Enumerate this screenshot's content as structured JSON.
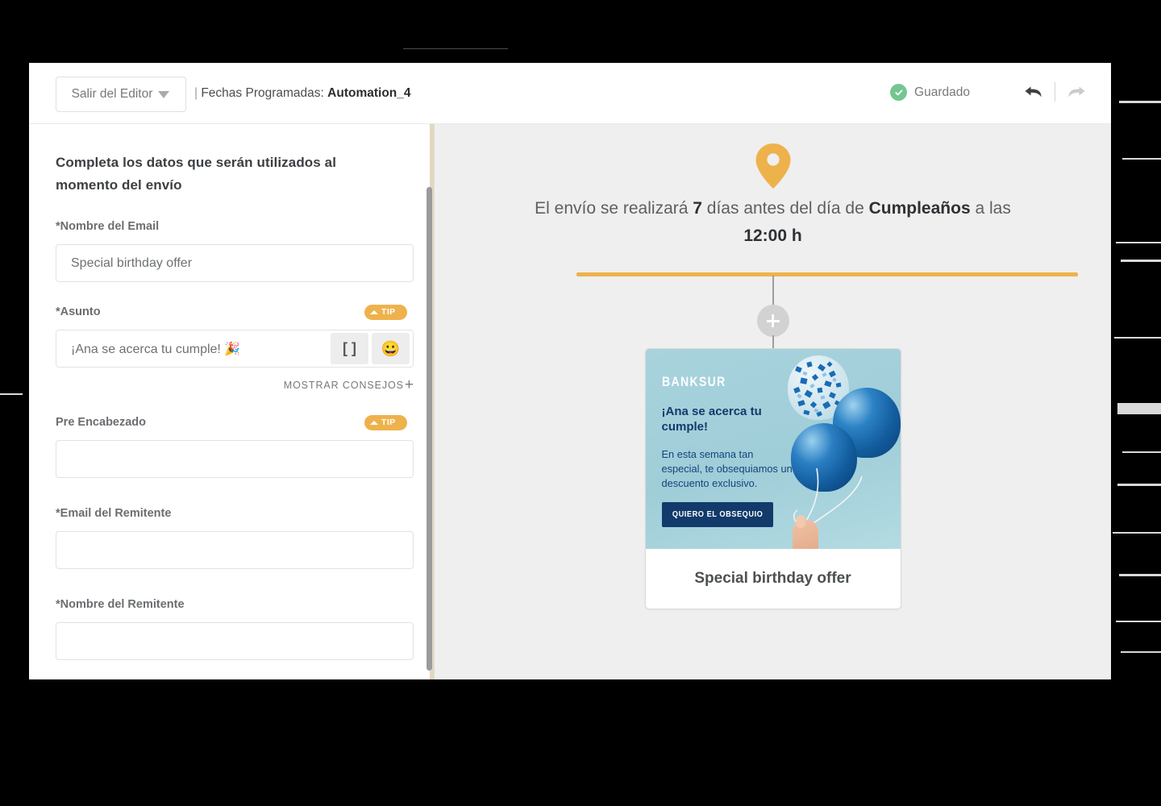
{
  "header": {
    "exit_button_label": "Salir del Editor",
    "breadcrumb_separator": "|",
    "breadcrumb_label": "Fechas Programadas:",
    "automation_name": "Automation_4",
    "saved_status": "Guardado",
    "undo_icon": "undo-arrow-icon",
    "redo_icon": "redo-arrow-icon",
    "dropdown_icon": "chevron-down-icon",
    "check_icon": "check-circle-icon"
  },
  "form": {
    "title": "Completa los datos que serán utilizados al momento del envío",
    "fields": [
      {
        "label": "*Nombre del Email",
        "value": "Special birthday offer",
        "placeholder": "",
        "tip": false
      },
      {
        "label": "*Asunto",
        "value": "¡Ana se acerca tu cumple! 🎉",
        "placeholder": "",
        "tip": true
      },
      {
        "label": "Pre Encabezado",
        "value": "",
        "placeholder": "",
        "tip": true
      },
      {
        "label": "*Email del Remitente",
        "value": "",
        "placeholder": "",
        "tip": false
      },
      {
        "label": "*Nombre del Remitente",
        "value": "",
        "placeholder": "",
        "tip": false
      }
    ],
    "tip_badge_label": "TIP",
    "merge_tag_button_label": "[ ]",
    "emoji_button_label": "😀",
    "show_tips_label": "MOSTRAR CONSEJOS",
    "show_tips_plus": "+"
  },
  "preview": {
    "pin_icon": "map-pin-icon",
    "schedule": {
      "prefix": "El envío se realizará ",
      "days": "7",
      "mid": " días antes del día de ",
      "event": "Cumpleaños",
      "suffix": " a las ",
      "time": "12:00 h"
    },
    "add_step_top_label": "+",
    "add_step_bottom_label": "+",
    "email_card": {
      "brand": "BANKSUR",
      "headline": "¡Ana se acerca tu cumple!",
      "body": "En esta semana tan especial, te obsequiamos un descuento exclusivo.",
      "cta": "QUIERO EL OBSEQUIO",
      "caption": "Special birthday offer"
    }
  },
  "colors": {
    "accent_orange": "#eeb24c",
    "saved_green": "#74c690",
    "add_green": "#52a861",
    "add_gray": "#d2d2d2",
    "creative_bg": "#a8d3dd",
    "creative_navy": "#123a6b",
    "panel_bg": "#efefef"
  }
}
